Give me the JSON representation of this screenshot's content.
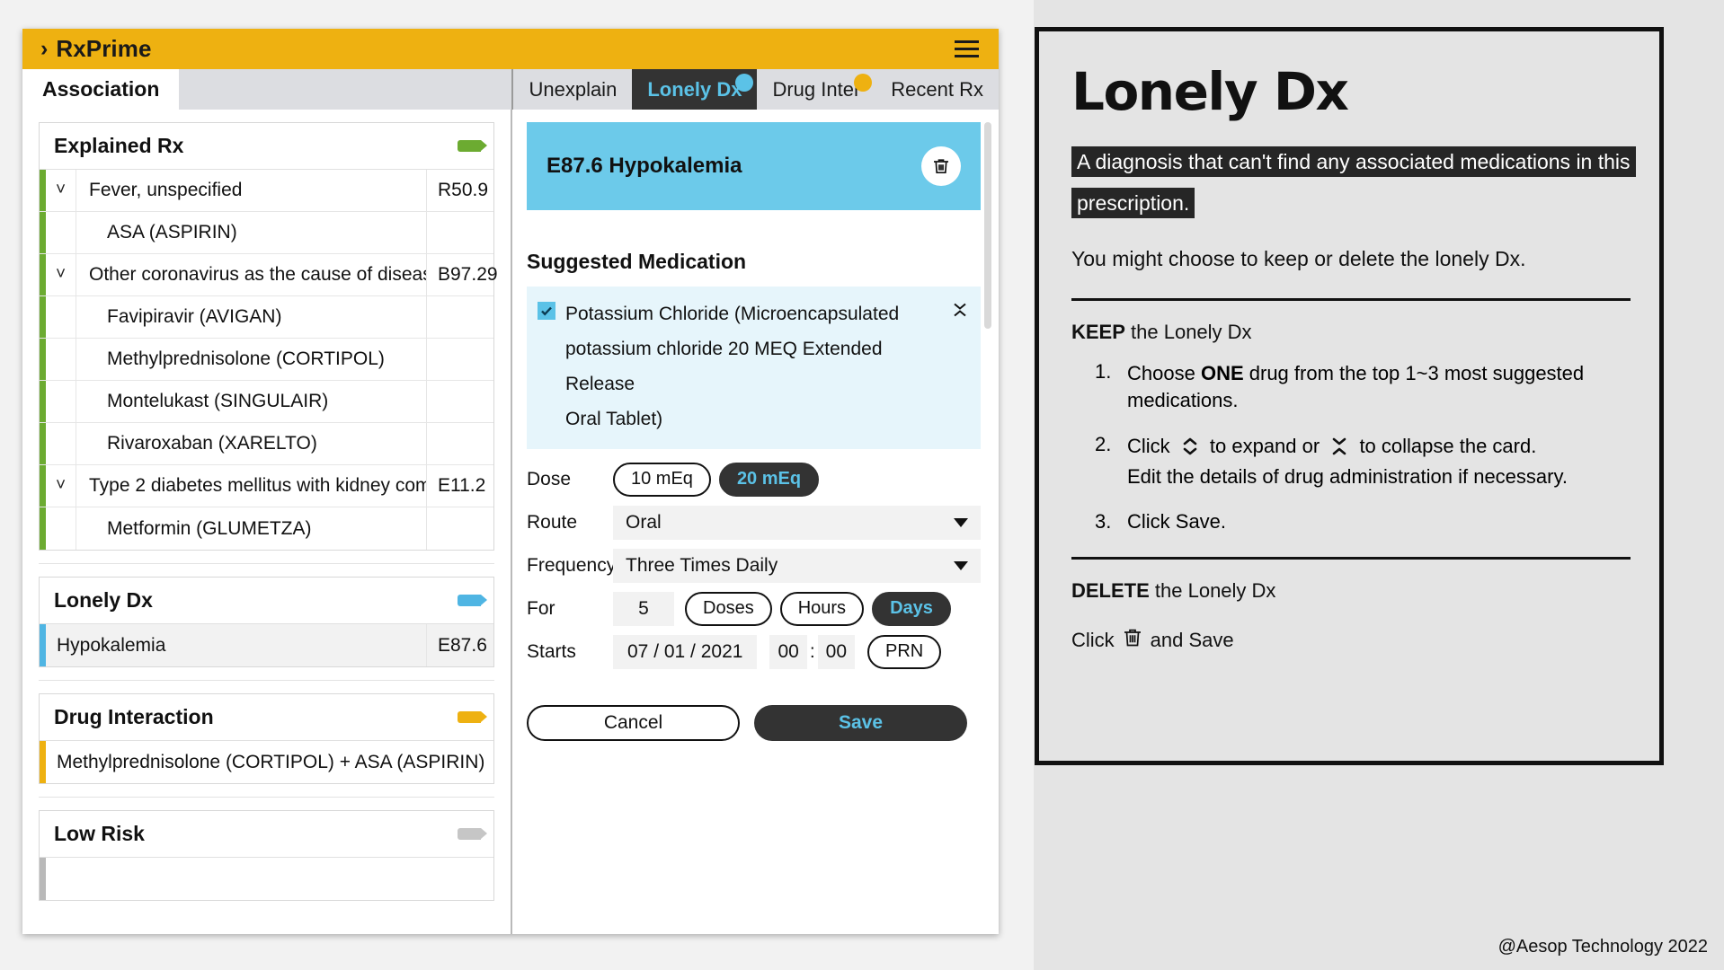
{
  "app": {
    "title": "RxPrime",
    "menu_icon": "hamburger-icon",
    "back_icon": "chevron-right-icon"
  },
  "left_tabs": [
    {
      "label": "Association",
      "active": true
    }
  ],
  "right_tabs": [
    {
      "label": "Unexplain",
      "active": false,
      "badge": null
    },
    {
      "label": "Lonely Dx",
      "active": true,
      "badge": "blue"
    },
    {
      "label": "Drug Inter",
      "active": false,
      "badge": "yellow"
    },
    {
      "label": "Recent Rx",
      "active": false,
      "badge": null
    }
  ],
  "sections": [
    {
      "title": "Explained Rx",
      "tag_color": "#6cab31",
      "rows": [
        {
          "name": "Fever, unspecified",
          "code": "R50.9",
          "chevron": "chevron-down-icon",
          "accent": "green",
          "indent": false
        },
        {
          "name": "ASA (ASPIRIN)",
          "code": "",
          "chevron": "",
          "accent": "green",
          "indent": true
        },
        {
          "name": "Other coronavirus as the cause of diseas",
          "code": "B97.29",
          "chevron": "chevron-down-icon",
          "accent": "green",
          "indent": false
        },
        {
          "name": "Favipiravir (AVIGAN)",
          "code": "",
          "chevron": "",
          "accent": "green",
          "indent": true
        },
        {
          "name": "Methylprednisolone (CORTIPOL)",
          "code": "",
          "chevron": "",
          "accent": "green",
          "indent": true
        },
        {
          "name": "Montelukast (SINGULAIR)",
          "code": "",
          "chevron": "",
          "accent": "green",
          "indent": true
        },
        {
          "name": "Rivaroxaban (XARELTO)",
          "code": "",
          "chevron": "",
          "accent": "green",
          "indent": true
        },
        {
          "name": "Type 2 diabetes mellitus with kidney com",
          "code": "E11.2",
          "chevron": "chevron-down-icon",
          "accent": "green",
          "indent": false
        },
        {
          "name": "Metformin (GLUMETZA)",
          "code": "",
          "chevron": "",
          "accent": "green",
          "indent": true
        }
      ]
    },
    {
      "title": "Lonely Dx",
      "tag_color": "#4fb5e3",
      "rows": [
        {
          "name": "Hypokalemia",
          "code": "E87.6",
          "accent": "blue",
          "highlight": true
        }
      ]
    },
    {
      "title": "Drug Interaction",
      "tag_color": "#eeb111",
      "rows": [
        {
          "name": "Methylprednisolone (CORTIPOL) + ASA (ASPIRIN)",
          "code": "",
          "accent": "amber",
          "highlight": false
        }
      ]
    },
    {
      "title": "Low Risk",
      "tag_color": "#c6c6c6",
      "rows": [
        {
          "name": "",
          "code": "",
          "accent": "gray",
          "highlight": false
        }
      ]
    }
  ],
  "detail": {
    "banner_title": "E87.6 Hypokalemia",
    "delete_icon": "trash-icon",
    "suggested_label": "Suggested Medication",
    "medication": {
      "checked": true,
      "name": "Potassium Chloride (Microencapsulated",
      "line2": "potassium chloride 20 MEQ Extended Release",
      "line3": "Oral Tablet)",
      "collapse_icon": "chevron-collapse-icon"
    },
    "fields": {
      "dose_label": "Dose",
      "dose_options": [
        "10 mEq",
        "20 mEq"
      ],
      "dose_selected": "20 mEq",
      "route_label": "Route",
      "route_value": "Oral",
      "frequency_label": "Frequency",
      "frequency_value": "Three Times Daily",
      "for_label": "For",
      "for_value": "5",
      "for_options": [
        "Doses",
        "Hours",
        "Days"
      ],
      "for_selected": "Days",
      "starts_label": "Starts",
      "starts_date": "07 / 01 / 2021",
      "starts_hour": "00",
      "starts_minute": "00",
      "starts_colon": ":",
      "prn_label": "PRN",
      "prn_selected": false
    },
    "cancel_label": "Cancel",
    "save_label": "Save"
  },
  "guide": {
    "title": "Lonely Dx",
    "highlight": "A diagnosis that can't find any associated medications in this prescription.",
    "subtitle": "You might choose to keep or delete the lonely Dx.",
    "keep_strong": "KEEP",
    "keep_rest": " the Lonely Dx",
    "steps": [
      {
        "num": "1.",
        "pre": "Choose ",
        "strong": "ONE",
        "post": " drug from the top 1~3 most suggested medications."
      },
      {
        "num": "2.",
        "pre": "Click ",
        "mid": " to expand or ",
        "post": " to collapse the card.",
        "line2": "Edit the details of drug administration if necessary."
      },
      {
        "num": "3.",
        "pre": "Click Save."
      }
    ],
    "delete_strong": "DELETE",
    "delete_rest": " the Lonely Dx",
    "delete_pre": "Click",
    "delete_post": "and Save",
    "credit": "@Aesop Technology 2022"
  }
}
